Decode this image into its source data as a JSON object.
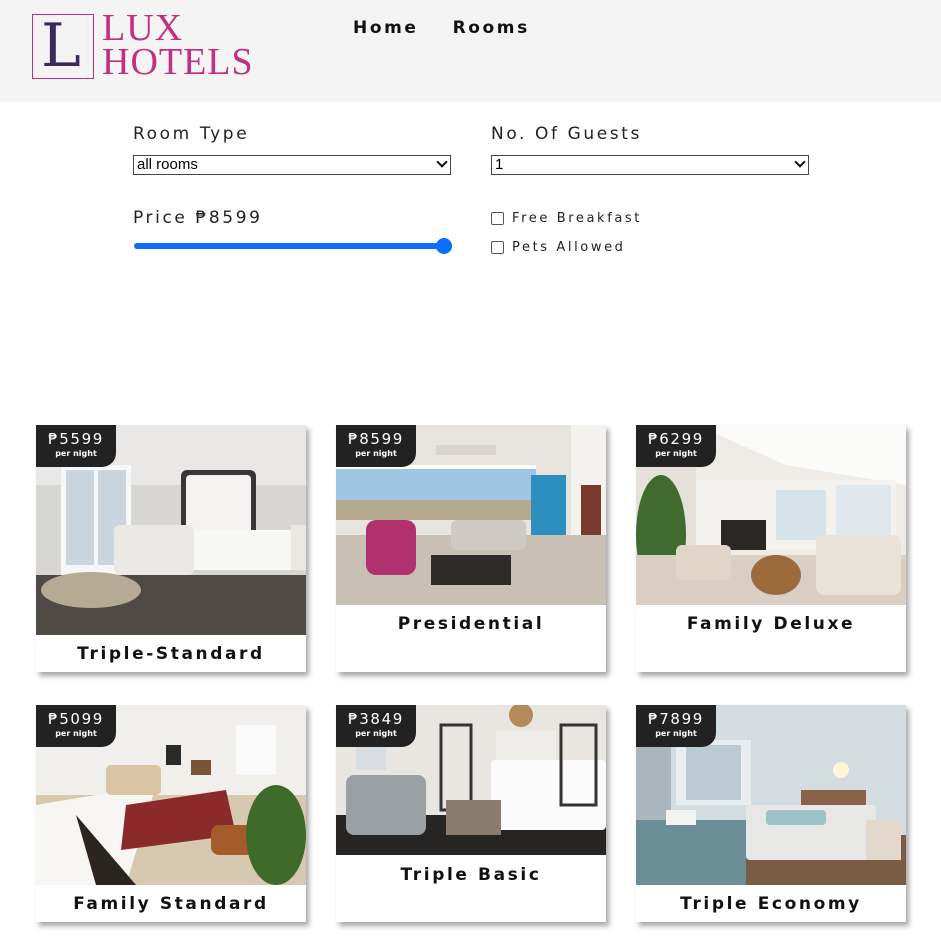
{
  "brand": {
    "letter": "L",
    "line1": "LUX",
    "line2": "HOTELS",
    "accent": "#c2307f"
  },
  "nav": {
    "home": "Home",
    "rooms": "Rooms"
  },
  "filters": {
    "room_type_label": "Room Type",
    "room_type_value": "all rooms",
    "guests_label": "No. Of Guests",
    "guests_value": "1",
    "price_label": "Price ₱8599",
    "price_fraction": 1.0,
    "breakfast_label": "Free Breakfast",
    "breakfast_checked": false,
    "pets_label": "Pets Allowed",
    "pets_checked": false
  },
  "per_night": "per night",
  "rooms": [
    {
      "price": "₱5599",
      "name": "Triple-Standard"
    },
    {
      "price": "₱8599",
      "name": "Presidential"
    },
    {
      "price": "₱6299",
      "name": "Family Deluxe"
    },
    {
      "price": "₱5099",
      "name": "Family Standard"
    },
    {
      "price": "₱3849",
      "name": "Triple Basic"
    },
    {
      "price": "₱7899",
      "name": "Triple Economy"
    }
  ]
}
